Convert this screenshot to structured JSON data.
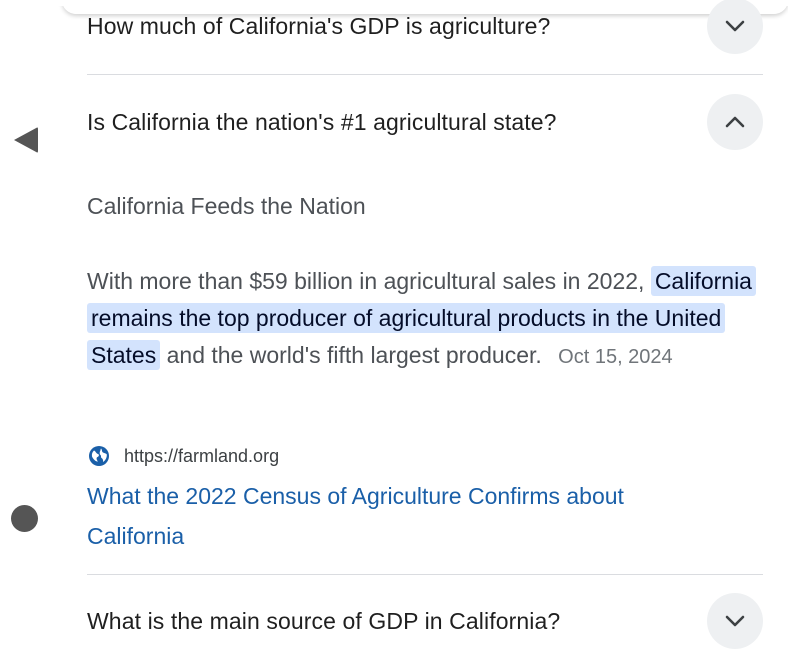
{
  "faq": {
    "q1": {
      "question": "How much of California's GDP is agriculture?",
      "expanded": false,
      "toggle_icon": "chevron-down-icon"
    },
    "q2": {
      "question": "Is California the nation's #1 agricultural state?",
      "expanded": true,
      "toggle_icon": "chevron-up-icon",
      "answer_heading": "California Feeds the Nation",
      "answer_prefix": "With more than $59 billion in agricultural sales in 2022,",
      "answer_highlight": "California remains the top producer of agricultural products in the United States",
      "answer_suffix": "and the world's fifth largest producer.",
      "answer_date": "Oct 15, 2024",
      "source_url": "https://farmland.org",
      "source_title": "What the 2022 Census of Agriculture Confirms about California",
      "source_icon": "globe-icon"
    },
    "q3": {
      "question": "What is the main source of GDP in California?",
      "expanded": false,
      "toggle_icon": "chevron-down-icon"
    }
  },
  "system_nav": {
    "back_icon": "back-triangle-icon",
    "home_icon": "home-circle-icon"
  },
  "colors": {
    "highlight_bg": "#d3e3fd",
    "link": "#1a5fa8",
    "text_primary": "#1f1f1f",
    "text_secondary": "#4d5156",
    "button_bg": "#eef0f2",
    "nav_icon": "#555555"
  }
}
